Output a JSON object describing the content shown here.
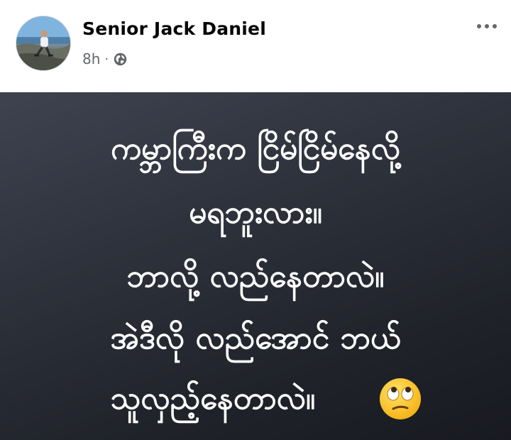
{
  "post": {
    "author": "Senior Jack Daniel",
    "timestamp": "8h",
    "meta_separator": "·",
    "privacy_icon": "globe-icon",
    "more_icon": "more-options-icon"
  },
  "content": {
    "background_color": "#2a2d35",
    "text_color": "#ffffff",
    "lines": [
      "ကမ္ဘာကြီးက ငြိမ်ငြိမ်နေလို့",
      "မရဘူးလား။",
      "ဘာလို့ လည်နေတာလဲ။",
      "အဲဒီလို လည်အောင် ဘယ်",
      "သူလှည့်နေတာလဲ။"
    ],
    "emoji": "face-with-rolling-eyes-icon"
  }
}
